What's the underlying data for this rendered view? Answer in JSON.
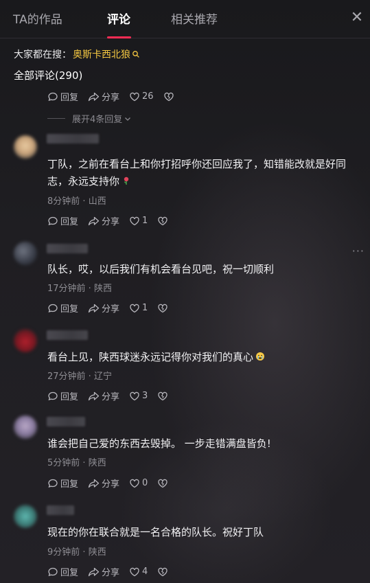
{
  "tabs": [
    {
      "label": "TA的作品"
    },
    {
      "label": "评论"
    },
    {
      "label": "相关推荐"
    }
  ],
  "active_tab": "评论",
  "close_label": "✕",
  "search": {
    "prefix": "大家都在搜：",
    "term": "奥斯卡西北狼"
  },
  "total_comments": "全部评论(290)",
  "first_actions": {
    "reply": "回复",
    "share": "分享",
    "likes": "26"
  },
  "expand_replies": "展开4条回复",
  "comments": [
    {
      "text": "丁队，之前在看台上和你打招呼你还回应我了，知错能改就是好同志，永远支持你",
      "emoji": "rose",
      "time": "8分钟前",
      "location": "山西",
      "reply": "回复",
      "share": "分享",
      "likes": "1"
    },
    {
      "text": "队长，哎，以后我们有机会看台见吧，祝一切顺利",
      "emoji": "",
      "time": "17分钟前",
      "location": "陕西",
      "reply": "回复",
      "share": "分享",
      "likes": "1"
    },
    {
      "text": "看台上见，陕西球迷永远记得你对我们的真心",
      "emoji": "crying-face",
      "time": "27分钟前",
      "location": "辽宁",
      "reply": "回复",
      "share": "分享",
      "likes": "3"
    },
    {
      "text": "谁会把自己爱的东西去毁掉。 一步走错满盘皆负!",
      "emoji": "",
      "time": "5分钟前",
      "location": "陕西",
      "reply": "回复",
      "share": "分享",
      "likes": "0"
    },
    {
      "text": "现在的你在联合就是一名合格的队长。祝好丁队",
      "emoji": "",
      "time": "9分钟前",
      "location": "陕西",
      "reply": "回复",
      "share": "分享",
      "likes": "4"
    }
  ],
  "meta_separator": " · ",
  "colors": {
    "accent": "#fe2c55",
    "search_term": "#f5c842",
    "background": "#1c1b1f"
  }
}
